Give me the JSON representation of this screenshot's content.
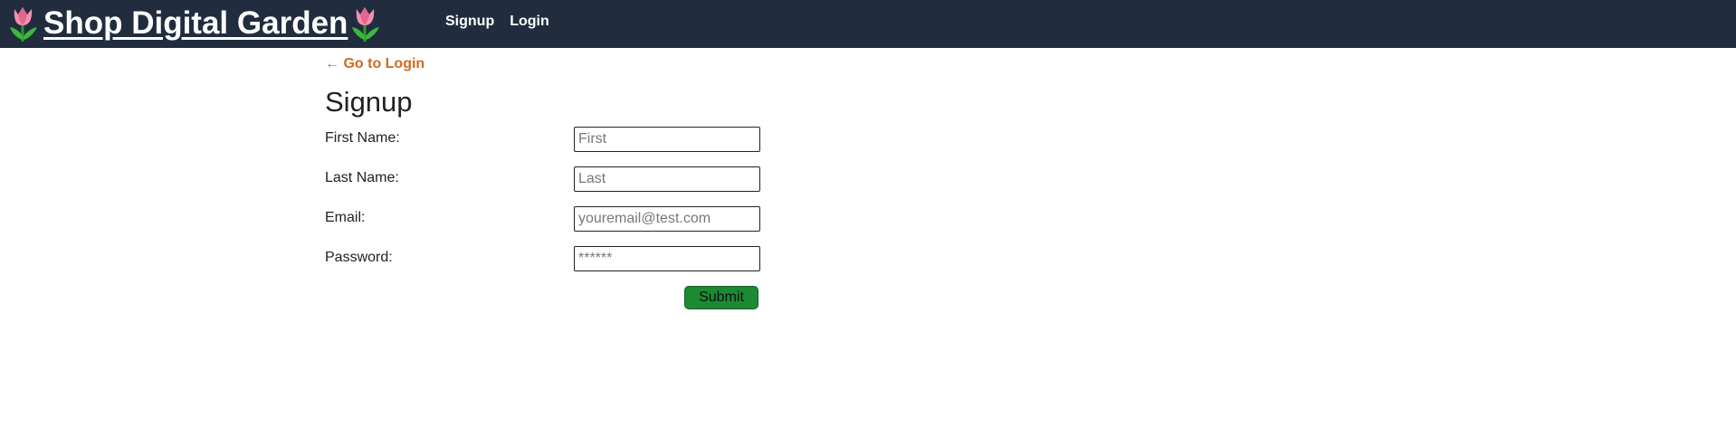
{
  "header": {
    "brand": "Shop Digital Garden",
    "brand_icon": "tulip-icon",
    "nav": {
      "signup": "Signup",
      "login": "Login"
    }
  },
  "main": {
    "back_link": "← Go to Login",
    "title": "Signup",
    "fields": {
      "first_name": {
        "label": "First Name:",
        "placeholder": "First"
      },
      "last_name": {
        "label": "Last Name:",
        "placeholder": "Last"
      },
      "email": {
        "label": "Email:",
        "placeholder": "youremail@test.com"
      },
      "password": {
        "label": "Password:",
        "placeholder": "******"
      }
    },
    "submit_label": "Submit"
  },
  "colors": {
    "header_bg": "#212d3f",
    "link_accent": "#d2691e",
    "submit_bg": "#1b8a33"
  }
}
